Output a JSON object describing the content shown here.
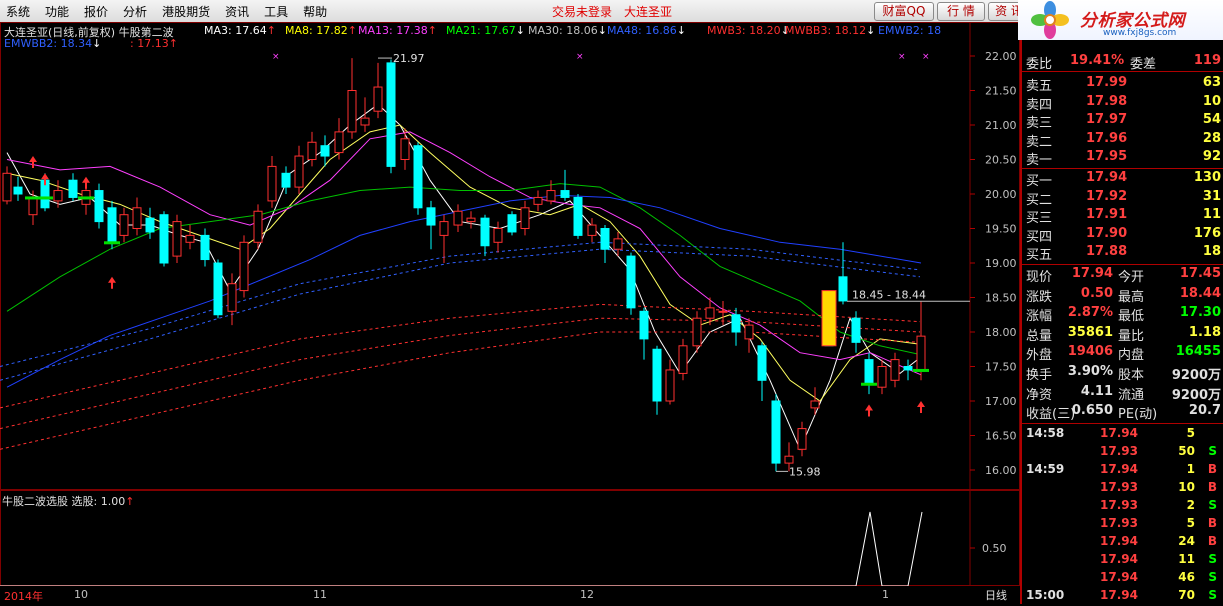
{
  "menu": [
    "系统",
    "功能",
    "报价",
    "分析",
    "港股期货",
    "资讯",
    "工具",
    "帮助"
  ],
  "status": {
    "login": "交易未登录",
    "stock": "大连圣亚"
  },
  "top_buttons": {
    "caifu": "财富QQ",
    "hangqing": "行 情",
    "zixun": "资 讯"
  },
  "logo": {
    "text": "分析家公式网",
    "url": "www.fxj8gs.com"
  },
  "chart": {
    "title": "大连圣亚(日线,前复权) 牛股第二波",
    "ma": [
      {
        "label": "MA3: 17.64",
        "arrow": "↑",
        "color": "#ffffff"
      },
      {
        "label": "MA8: 17.82",
        "arrow": "↑",
        "color": "#ffff00"
      },
      {
        "label": "MA13: 17.38",
        "arrow": "↑",
        "color": "#ff40ff"
      },
      {
        "label": "MA21: 17.67",
        "arrow": "↓",
        "color": "#00ff00"
      },
      {
        "label": "MA30: 18.06",
        "arrow": "↓",
        "color": "#c0c0c0"
      },
      {
        "label": "MA48: 16.86",
        "arrow": "↓",
        "color": "#3060ff"
      },
      {
        "label": "MWB3: 18.20",
        "arrow": "↓",
        "color": "#ff3030"
      },
      {
        "label": "MWBB3: 18.12",
        "arrow": "↓",
        "color": "#ff3030"
      },
      {
        "label": "EMWB2: 18",
        "arrow": "",
        "color": "#3060ff"
      }
    ],
    "ma_row2": [
      {
        "label": "EMWBB2: 18.34",
        "arrow": "↓",
        "color": "#3060ff"
      },
      {
        "label": ": 17.13",
        "arrow": "↑",
        "color": "#ff3030"
      }
    ],
    "price_ticks": [
      "22.00",
      "21.50",
      "21.00",
      "20.50",
      "20.00",
      "19.50",
      "19.00",
      "18.50",
      "18.00",
      "17.50",
      "17.00",
      "16.50",
      "16.00"
    ],
    "annotations": {
      "high": "21.97",
      "low": "15.98",
      "box": "18.45 - 18.44"
    },
    "indicator_title": "牛股二波选股  选股: 1.00",
    "indicator_arrow": "↑",
    "indicator_tick": "0.50",
    "dates": [
      "2014年",
      "10",
      "11",
      "12",
      "1"
    ],
    "period": "日线"
  },
  "order_book": {
    "ratio": {
      "label": "委比",
      "value": "19.41%",
      "label2": "委差",
      "value2": "119"
    },
    "asks": [
      {
        "label": "卖五",
        "price": "17.99",
        "vol": "63"
      },
      {
        "label": "卖四",
        "price": "17.98",
        "vol": "10"
      },
      {
        "label": "卖三",
        "price": "17.97",
        "vol": "54"
      },
      {
        "label": "卖二",
        "price": "17.96",
        "vol": "28"
      },
      {
        "label": "卖一",
        "price": "17.95",
        "vol": "92"
      }
    ],
    "bids": [
      {
        "label": "买一",
        "price": "17.94",
        "vol": "130"
      },
      {
        "label": "买二",
        "price": "17.92",
        "vol": "31"
      },
      {
        "label": "买三",
        "price": "17.91",
        "vol": "11"
      },
      {
        "label": "买四",
        "price": "17.90",
        "vol": "176"
      },
      {
        "label": "买五",
        "price": "17.88",
        "vol": "18"
      }
    ]
  },
  "quote": [
    {
      "l1": "现价",
      "v1": "17.94",
      "c1": "#ff4040",
      "l2": "今开",
      "v2": "17.45",
      "c2": "#ff4040"
    },
    {
      "l1": "涨跌",
      "v1": "0.50",
      "c1": "#ff4040",
      "l2": "最高",
      "v2": "18.44",
      "c2": "#ff4040"
    },
    {
      "l1": "涨幅",
      "v1": "2.87%",
      "c1": "#ff4040",
      "l2": "最低",
      "v2": "17.30",
      "c2": "#00ff00"
    },
    {
      "l1": "总量",
      "v1": "35861",
      "c1": "#ffff40",
      "l2": "量比",
      "v2": "1.18",
      "c2": "#ffff40"
    },
    {
      "l1": "外盘",
      "v1": "19406",
      "c1": "#ff4040",
      "l2": "内盘",
      "v2": "16455",
      "c2": "#00ff00"
    },
    {
      "l1": "换手",
      "v1": "3.90%",
      "c1": "#e0e0e0",
      "l2": "股本",
      "v2": "9200万",
      "c2": "#e0e0e0"
    },
    {
      "l1": "净资",
      "v1": "4.11",
      "c1": "#e0e0e0",
      "l2": "流通",
      "v2": "9200万",
      "c2": "#e0e0e0"
    },
    {
      "l1": "收益(三)",
      "v1": "0.650",
      "c1": "#e0e0e0",
      "l2": "PE(动)",
      "v2": "20.7",
      "c2": "#e0e0e0"
    }
  ],
  "ticks": [
    {
      "time": "14:58",
      "price": "17.94",
      "vol": "5",
      "side": ""
    },
    {
      "time": "",
      "price": "17.93",
      "vol": "50",
      "side": "S"
    },
    {
      "time": "14:59",
      "price": "17.94",
      "vol": "1",
      "side": "B"
    },
    {
      "time": "",
      "price": "17.93",
      "vol": "10",
      "side": "B"
    },
    {
      "time": "",
      "price": "17.93",
      "vol": "2",
      "side": "S"
    },
    {
      "time": "",
      "price": "17.93",
      "vol": "5",
      "side": "B"
    },
    {
      "time": "",
      "price": "17.94",
      "vol": "24",
      "side": "B"
    },
    {
      "time": "",
      "price": "17.94",
      "vol": "11",
      "side": "S"
    },
    {
      "time": "",
      "price": "17.94",
      "vol": "46",
      "side": "S"
    },
    {
      "time": "15:00",
      "price": "17.94",
      "vol": "70",
      "side": "S"
    }
  ],
  "colors": {
    "up": "#ff3030",
    "down": "#00ffff",
    "grid": "#800000",
    "ma3": "#ffffff",
    "ma8": "#ffff60",
    "ma13": "#ff40ff",
    "ma21": "#00c000",
    "ma48": "#2040ff"
  }
}
